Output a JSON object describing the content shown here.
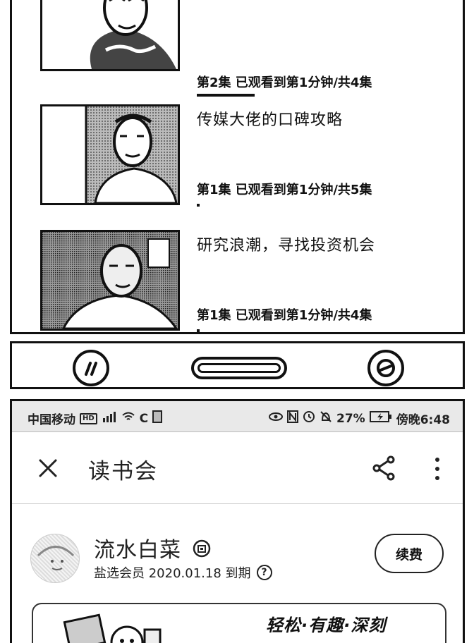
{
  "episodes": [
    {
      "title": "",
      "progress_text": "第2集 已观看到第1分钟/共4集",
      "progress": 0.5
    },
    {
      "title": "传媒大佬的口碑攻略",
      "progress_text": "第1集 已观看到第1分钟/共5集",
      "progress": 0.02
    },
    {
      "title": "研究浪潮，寻找投资机会",
      "progress_text": "第1集 已观看到第1分钟/共4集",
      "progress": 0.02
    }
  ],
  "nav_icons": {
    "left": "mini-program-icon",
    "right": "browser-icon"
  },
  "status_bar": {
    "carrier": "中国移动",
    "hd": "HD",
    "signal": "⁴ᴳ",
    "wifi": "◠",
    "sync": "C",
    "battery": "27%",
    "time": "傍晚6:48"
  },
  "app": {
    "title": "读书会",
    "close_icon": "close-icon",
    "share_icon": "share-icon",
    "more_icon": "more-vertical-icon"
  },
  "profile": {
    "name": "流水白菜",
    "member_text": "盐选会员 2020.01.18 到期",
    "help": "?",
    "renew_label": "续费"
  },
  "banner": {
    "slogan": "轻松·有趣·深刻"
  }
}
